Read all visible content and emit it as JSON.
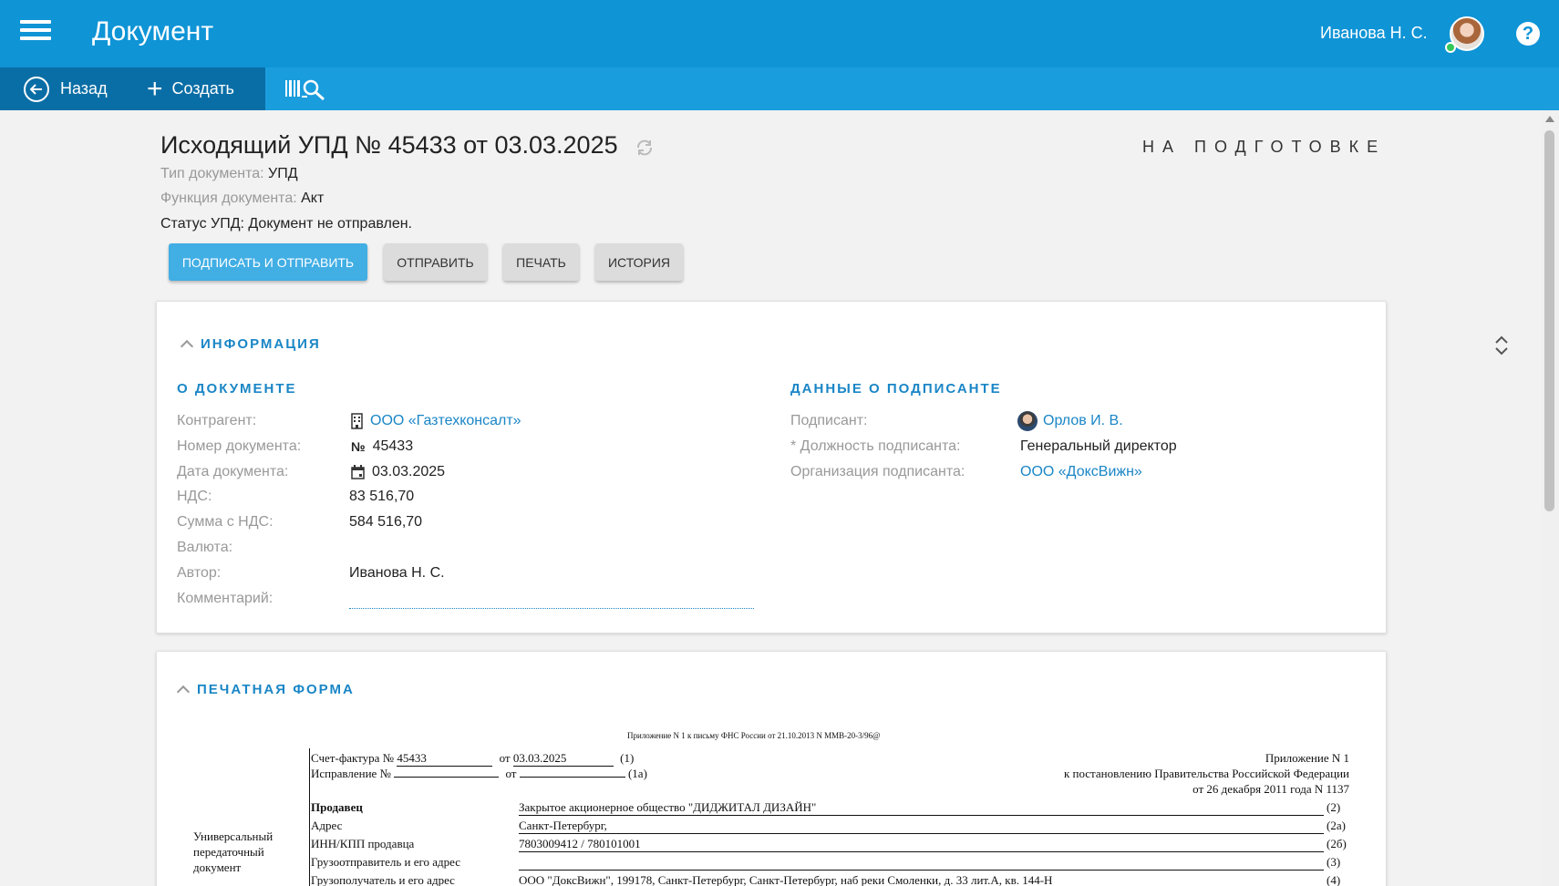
{
  "app": {
    "title": "Документ",
    "user_name": "Иванова Н. С.",
    "help_glyph": "?"
  },
  "toolbar": {
    "back_label": "Назад",
    "create_label": "Создать"
  },
  "header": {
    "title": "Исходящий УПД № 45433 от 03.03.2025",
    "status": "НА ПОДГОТОВКЕ",
    "doc_type_label": "Тип документа:",
    "doc_type_value": "УПД",
    "doc_function_label": "Функция документа:",
    "doc_function_value": "Акт",
    "upd_status": "Статус УПД: Документ не отправлен."
  },
  "actions": {
    "sign_send": "Подписать и отправить",
    "send": "Отправить",
    "print": "Печать",
    "history": "История"
  },
  "info": {
    "title": "ИНФОРМАЦИЯ",
    "doc_section": "О ДОКУМЕНТЕ",
    "signer_section": "ДАННЫЕ О ПОДПИСАНТЕ",
    "fields": {
      "counterparty_label": "Контрагент:",
      "counterparty_value": "ООО «Газтехконсалт»",
      "number_label": "Номер документа:",
      "number_value": "45433",
      "number_glyph": "№",
      "date_label": "Дата документа:",
      "date_value": "03.03.2025",
      "vat_label": "НДС:",
      "vat_value": "83 516,70",
      "sum_label": "Сумма с НДС:",
      "sum_value": "584 516,70",
      "currency_label": "Валюта:",
      "author_label": "Автор:",
      "author_value": "Иванова Н. С.",
      "comment_label": "Комментарий:"
    },
    "signer": {
      "signer_label": "Подписант:",
      "signer_value": "Орлов И. В.",
      "position_label": "* Должность подписанта:",
      "position_value": "Генеральный директор",
      "org_label": "Организация подписанта:",
      "org_value": "ООО «ДоксВижн»"
    }
  },
  "print_form": {
    "title": "ПЕЧАТНАЯ ФОРМА",
    "appendix_note": "Приложение N 1 к письму ФНС России от 21.10.2013 N ММВ-20-3/96@",
    "invoice_label": "Счет-фактура №",
    "invoice_number": "45433",
    "from_label": "от",
    "invoice_date": "03.03.2025",
    "correction_label": "Исправление №",
    "code_1": "(1)",
    "code_1a": "(1а)",
    "right_1": "Приложение N 1",
    "right_2": "к постановлению Правительства Российской Федерации",
    "right_3": "от 26 декабря 2011 года N 1137",
    "upd_label_1": "Универсальный",
    "upd_label_2": "передаточный",
    "upd_label_3": "документ",
    "rows": [
      {
        "label": "Продавец",
        "value": "Закрытое акционерное общество \"ДИДЖИТАЛ ДИЗАЙН\"",
        "code": "(2)"
      },
      {
        "label": "Адрес",
        "value": "Санкт-Петербург,",
        "code": "(2а)"
      },
      {
        "label": "ИНН/КПП продавца",
        "value": "7803009412 / 780101001",
        "code": "(2б)"
      },
      {
        "label": "Грузоотправитель и его адрес",
        "value": "",
        "code": "(3)"
      },
      {
        "label": "Грузополучатель и его адрес",
        "value": "ООО \"ДоксВижн\", 199178, Санкт-Петербург, Санкт-Петербург, наб реки Смоленки, д. 33 лит.А, кв. 144-Н",
        "code": "(4)"
      }
    ]
  }
}
